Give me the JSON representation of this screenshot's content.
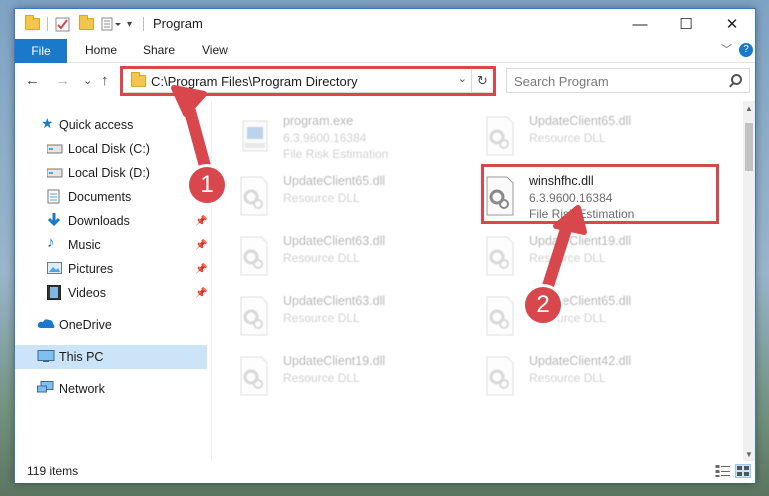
{
  "window": {
    "title": "Program",
    "controls": {
      "minimize": "—",
      "maximize": "☐",
      "close": "✕"
    }
  },
  "ribbon": {
    "tabs": [
      {
        "label": "File",
        "active": true
      },
      {
        "label": "Home"
      },
      {
        "label": "Share"
      },
      {
        "label": "View"
      }
    ],
    "expand_glyph": "﹀",
    "help_glyph": "?"
  },
  "address_bar": {
    "path": "C:\\Program Files\\Program Directory",
    "dropdown_glyph": "⌄",
    "refresh_glyph": "↻"
  },
  "search": {
    "placeholder": "Search Program"
  },
  "nav": {
    "back": "←",
    "forward": "→",
    "recent": "⌄",
    "up": "↑"
  },
  "sidebar": {
    "items": [
      {
        "label": "Quick access",
        "icon": "star-icon",
        "pinned": false
      },
      {
        "label": "Local Disk (C:)",
        "icon": "drive-icon",
        "pinned": true
      },
      {
        "label": "Local Disk (D:)",
        "icon": "drive-icon",
        "pinned": true
      },
      {
        "label": "Documents",
        "icon": "documents-icon",
        "pinned": true
      },
      {
        "label": "Downloads",
        "icon": "download-icon",
        "pinned": true
      },
      {
        "label": "Music",
        "icon": "music-icon",
        "pinned": true
      },
      {
        "label": "Pictures",
        "icon": "pictures-icon",
        "pinned": true
      },
      {
        "label": "Videos",
        "icon": "videos-icon",
        "pinned": true
      },
      {
        "label": "OneDrive",
        "icon": "cloud-icon",
        "pinned": false
      },
      {
        "label": "This PC",
        "icon": "computer-icon",
        "pinned": false,
        "selected": true
      },
      {
        "label": "Network",
        "icon": "network-icon",
        "pinned": false
      }
    ],
    "pin_glyph": "📌"
  },
  "files": [
    {
      "name": "program.exe",
      "line2": "6.3.9600.16384",
      "line3": "File Risk Estimation",
      "kind": "exe",
      "faded": true
    },
    {
      "name": "UpdateClient65.dll",
      "line2": "Resource DLL",
      "line3": "",
      "kind": "dll",
      "faded": true
    },
    {
      "name": "UpdateClient65.dll",
      "line2": "Resource DLL",
      "line3": "",
      "kind": "dll",
      "faded": true
    },
    {
      "name": "winshfhc.dll",
      "line2": "6.3.9600.16384",
      "line3": "File Risk Estimation",
      "kind": "dll",
      "faded": false
    },
    {
      "name": "UpdateClient63.dll",
      "line2": "Resource DLL",
      "line3": "",
      "kind": "dll",
      "faded": true
    },
    {
      "name": "UpdateClient19.dll",
      "line2": "Resource DLL",
      "line3": "",
      "kind": "dll",
      "faded": true
    },
    {
      "name": "UpdateClient63.dll",
      "line2": "Resource DLL",
      "line3": "",
      "kind": "dll",
      "faded": true
    },
    {
      "name": "UpdateClient65.dll",
      "line2": "Resource DLL",
      "line3": "",
      "kind": "dll",
      "faded": true
    },
    {
      "name": "UpdateClient19.dll",
      "line2": "Resource DLL",
      "line3": "",
      "kind": "dll",
      "faded": true
    },
    {
      "name": "UpdateClient42.dll",
      "line2": "Resource DLL",
      "line3": "",
      "kind": "dll",
      "faded": true
    }
  ],
  "status": {
    "item_count": "119 items"
  },
  "annotations": {
    "callout_1": "1",
    "callout_2": "2",
    "color": "#d8474b"
  },
  "colors": {
    "accent": "#1979ca",
    "selection": "#cce4f7",
    "highlight_box": "#d8474b"
  }
}
